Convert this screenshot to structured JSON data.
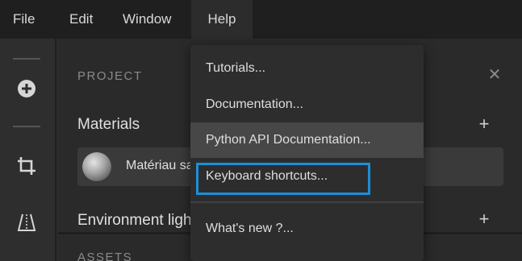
{
  "menubar": {
    "items": [
      "File",
      "Edit",
      "Window",
      "Help"
    ]
  },
  "toolbar": {
    "icons": [
      "add-circle-icon",
      "crop-icon",
      "perspective-icon"
    ]
  },
  "panel": {
    "section_title": "PROJECT",
    "close_glyph": "✕",
    "groups": [
      {
        "label": "Materials",
        "add_glyph": "+"
      },
      {
        "label": "Environment ligh",
        "add_glyph": "+"
      }
    ],
    "material": {
      "name": "Matériau sa"
    },
    "assets_title": "ASSETS"
  },
  "help_menu": {
    "items": [
      "Tutorials...",
      "Documentation...",
      "Python API Documentation...",
      "Keyboard shortcuts...",
      "What's new ?..."
    ]
  },
  "colors": {
    "focus_outline": "#1b8fd6",
    "menubar_bg": "#1f1f1f",
    "panel_bg": "#2a2a2a",
    "dropdown_bg": "#2d2d2d"
  }
}
